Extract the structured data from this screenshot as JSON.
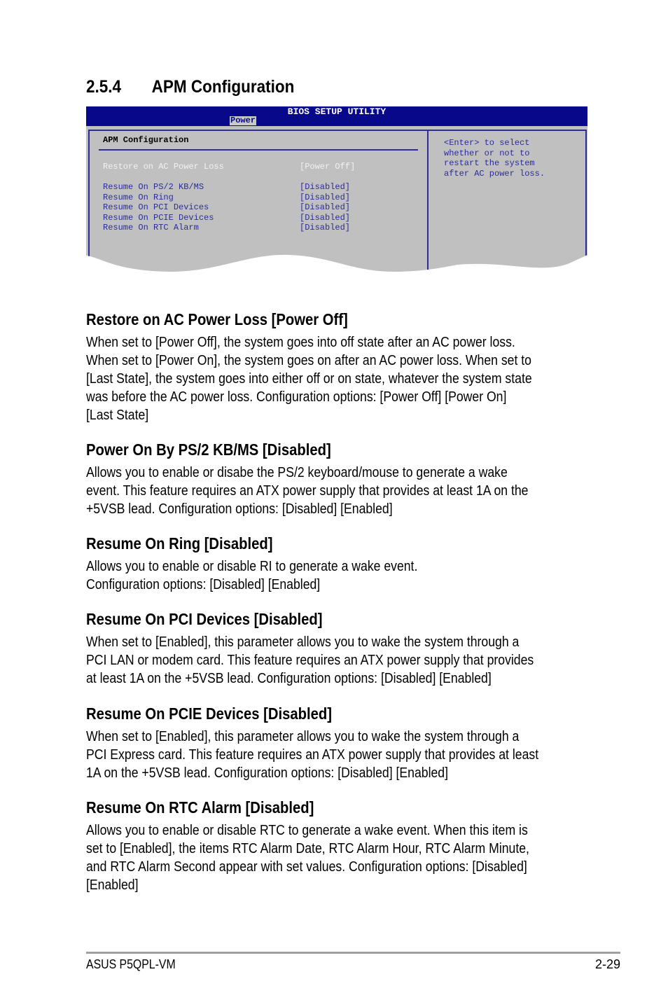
{
  "section_number": "2.5.4",
  "section_title": "APM Configuration",
  "bios": {
    "title": "BIOS SETUP UTILITY",
    "tab": "Power",
    "subtitle": "APM Configuration",
    "items": [
      {
        "label": "Restore on AC Power Loss",
        "value": "[Power Off]",
        "selected": true
      },
      {
        "label": "Resume On PS/2 KB/MS",
        "value": "[Disabled]"
      },
      {
        "label": "Resume On Ring",
        "value": "[Disabled]"
      },
      {
        "label": "Resume On PCI Devices",
        "value": "[Disabled]"
      },
      {
        "label": "Resume On PCIE Devices",
        "value": "[Disabled]"
      },
      {
        "label": "Resume On RTC Alarm",
        "value": "[Disabled]"
      }
    ],
    "help": [
      "<Enter> to select",
      "whether or not to",
      "restart the system",
      "after AC power loss."
    ],
    "colors": {
      "header": "#08088a",
      "panel": "#c0c0c0",
      "text": "#2b2b9a"
    }
  },
  "sections": [
    {
      "heading": "Restore on AC Power Loss [Power Off]",
      "lines": [
        "When set to [Power Off], the system goes into off state after an AC power loss.",
        "When set to [Power On], the system goes on after an AC power loss. When set to",
        "[Last State], the system goes into either off or on state, whatever the system state",
        "was before the AC power loss. Configuration options: [Power Off] [Power On]",
        "[Last State]"
      ]
    },
    {
      "heading": "Power On By PS/2 KB/MS [Disabled]",
      "lines": [
        "Allows you to enable or disabe the PS/2 keyboard/mouse to generate a wake",
        "event. This feature requires an ATX power supply that provides at least 1A on the",
        "+5VSB lead. Configuration options: [Disabled] [Enabled]"
      ]
    },
    {
      "heading": "Resume On Ring [Disabled]",
      "lines": [
        "Allows you to enable or disable RI to generate a wake event.",
        "Configuration options: [Disabled] [Enabled]"
      ]
    },
    {
      "heading": "Resume On PCI Devices [Disabled]",
      "lines": [
        "When set to [Enabled], this parameter allows you to wake the system through a",
        "PCI LAN or modem card. This feature requires an ATX power supply that provides",
        "at least 1A on the +5VSB lead. Configuration options: [Disabled] [Enabled]"
      ]
    },
    {
      "heading": "Resume On PCIE Devices [Disabled]",
      "lines": [
        "When set to [Enabled], this parameter allows you to wake the system through a",
        "PCI Express card. This feature requires an ATX power supply that provides at least",
        "1A on the +5VSB lead. Configuration options: [Disabled] [Enabled]"
      ]
    },
    {
      "heading": "Resume On RTC Alarm [Disabled]",
      "lines": [
        "Allows you to enable or disable RTC to generate a wake event. When this item is",
        "set to [Enabled], the items RTC Alarm Date, RTC Alarm Hour, RTC Alarm Minute,",
        "and RTC Alarm Second appear with set values. Configuration options: [Disabled]",
        "[Enabled]"
      ]
    }
  ],
  "footer": {
    "left": "ASUS P5QPL-VM",
    "right": "2-29"
  }
}
